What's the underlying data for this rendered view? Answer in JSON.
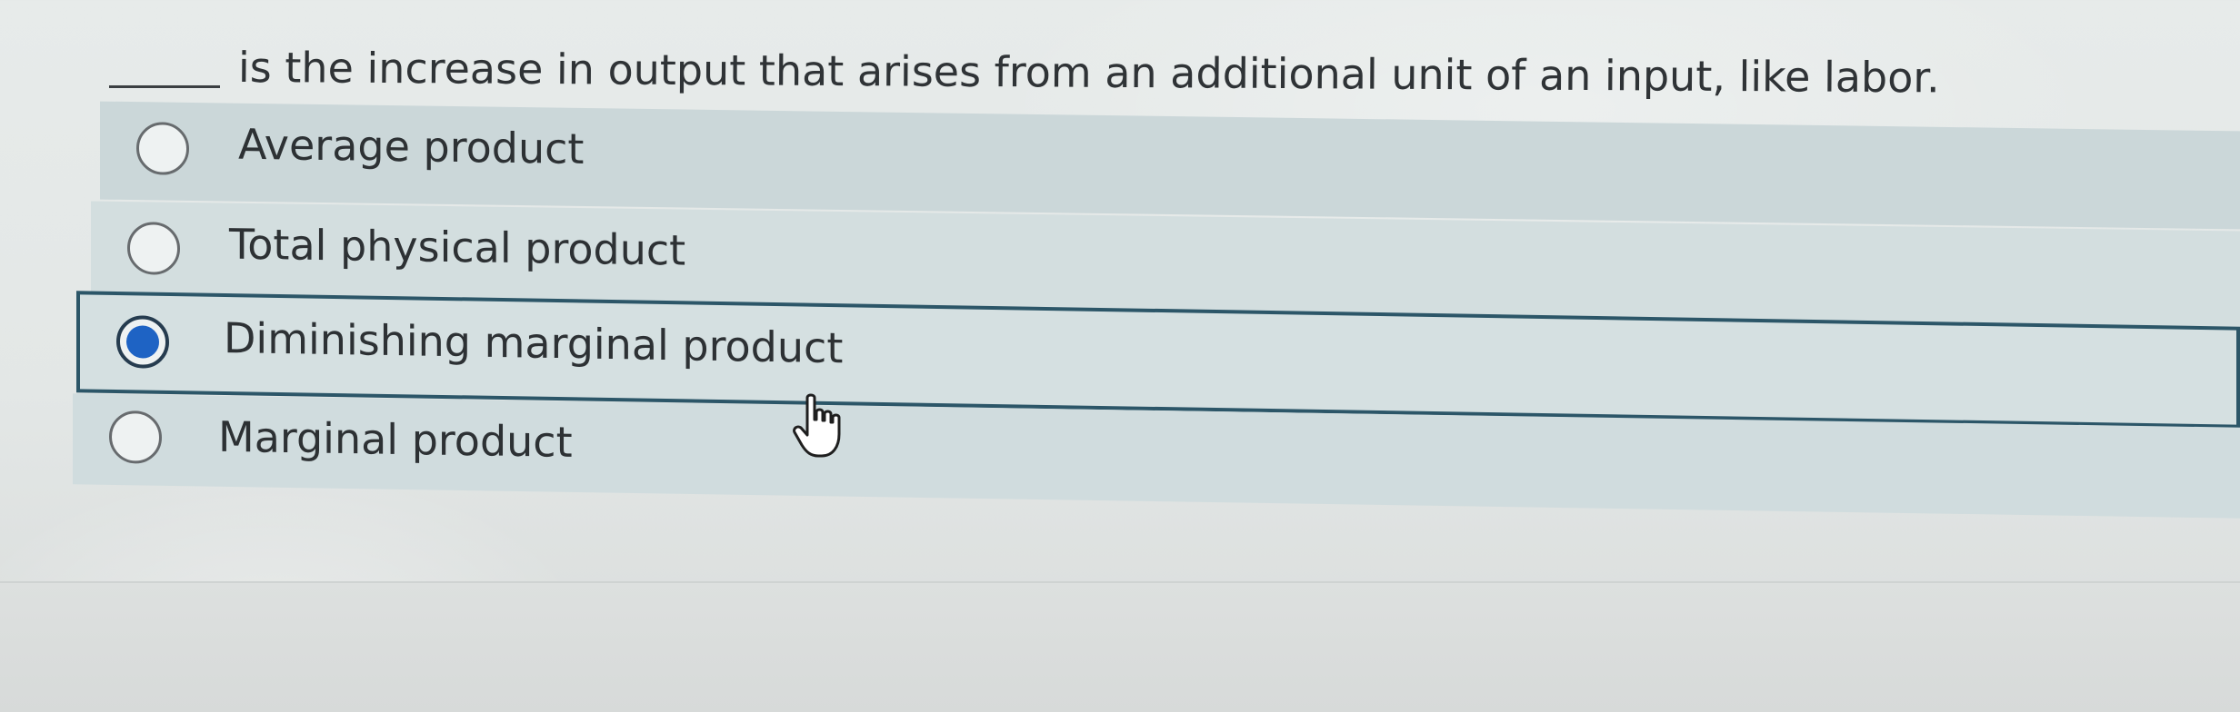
{
  "question": {
    "text": "is the increase in output that arises from an additional unit of an input, like labor."
  },
  "options": [
    {
      "label": "Average product",
      "selected": false
    },
    {
      "label": "Total physical product",
      "selected": false
    },
    {
      "label": "Diminishing marginal product",
      "selected": true
    },
    {
      "label": "Marginal product",
      "selected": false
    }
  ],
  "colors": {
    "selected_radio": "#1e63c4",
    "selected_border": "#2c5668",
    "option_background": "#cfdbdc"
  },
  "icons": {
    "cursor": "hand-pointer-icon"
  }
}
